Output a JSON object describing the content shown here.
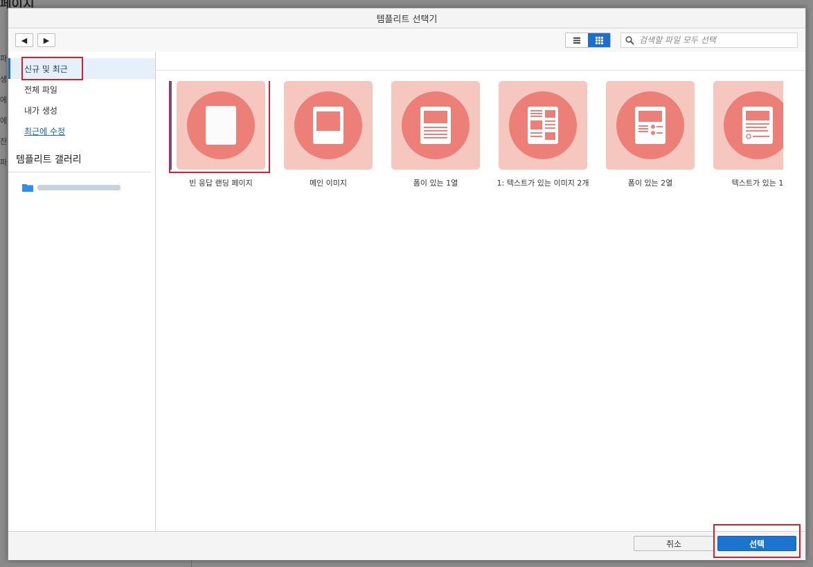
{
  "background": {
    "page_title": "페이지",
    "side_chars": [
      "파",
      "생",
      "에",
      "에",
      "잔",
      "파"
    ]
  },
  "dialog": {
    "title": "템플리트 선택기"
  },
  "toolbar": {
    "back_icon": "◀",
    "forward_icon": "▶",
    "view_list_icon": "list-view-icon",
    "view_grid_icon": "grid-view-icon",
    "search_placeholder": "검색할 파일 모두 선택"
  },
  "sidebar": {
    "items": [
      {
        "label": "신규 및 최근",
        "selected": true
      },
      {
        "label": "전체 파일",
        "selected": false
      },
      {
        "label": "내가 생성",
        "selected": false
      },
      {
        "label": "최근에 수정",
        "selected": false
      }
    ],
    "gallery_heading": "템플리트 갤러리"
  },
  "templates": [
    {
      "label": "빈 응답 랜딩 페이지",
      "icon": "blank-page-icon"
    },
    {
      "label": "메인 이미지",
      "icon": "main-image-icon"
    },
    {
      "label": "폼이 있는 1열",
      "icon": "one-column-form-icon"
    },
    {
      "label": "1: 텍스트가 있는 이미지 2개",
      "icon": "two-images-text-icon"
    },
    {
      "label": "폼이 있는 2열",
      "icon": "two-column-form-icon"
    },
    {
      "label": "텍스트가 있는 1",
      "icon": "text-image-icon"
    }
  ],
  "footer": {
    "cancel_label": "취소",
    "select_label": "선택"
  },
  "colors": {
    "accent": "#1b6fcd",
    "tile_bg": "#f6c7bf",
    "tile_circle": "#ec8079",
    "highlight": "#d61f2a"
  }
}
